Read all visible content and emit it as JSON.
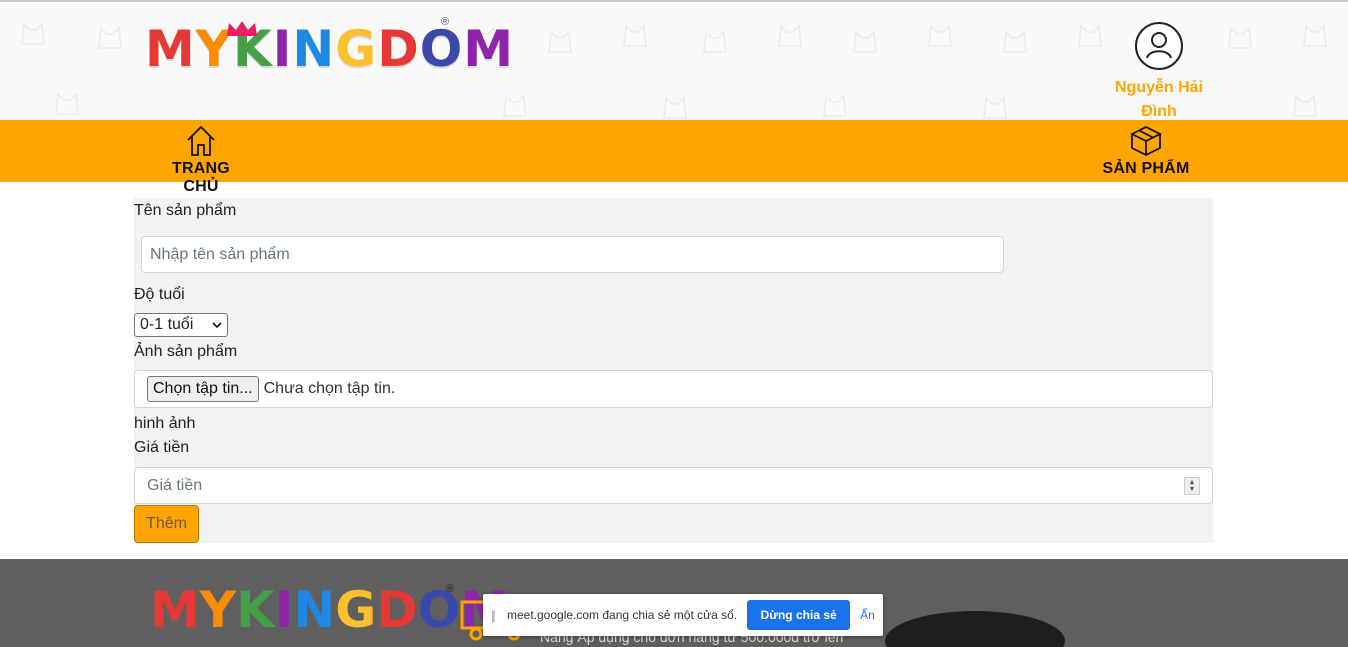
{
  "header": {
    "logo_text": "MYKINGDOM",
    "logo_registered": "®",
    "user_name": "Nguyễn Hải Đình"
  },
  "nav": {
    "home_label": "TRANG CHỦ",
    "products_label": "SẢN PHẨM"
  },
  "form": {
    "name_label": "Tên sản phẩm",
    "name_placeholder": "Nhập tên sản phẩm",
    "name_value": "",
    "age_label": "Độ tuổi",
    "age_selected": "0-1 tuổi",
    "image_label": "Ảnh sản phẩm",
    "file_button": "Chọn tập tin...",
    "file_status": "Chưa chọn tập tin.",
    "image_caption": "hinh ảnh",
    "price_label": "Giá tiền",
    "price_placeholder": "Giá tiền",
    "price_value": "",
    "submit_label": "Thêm"
  },
  "footer": {
    "logo_text": "MYKINGDOM",
    "logo_registered": "®",
    "shipping_text": "Nâng Áp dụng cho đơn hàng từ 500.000đ trở lên"
  },
  "share_bar": {
    "message": "meet.google.com đang chia sẻ một cửa sổ.",
    "stop_label": "Dừng chia sẻ",
    "hide_label": "Ẩn"
  },
  "colors": {
    "accent": "#ffa500",
    "footer_bg": "#5f5f5f",
    "share_button": "#1a73e8"
  },
  "icons": [
    "home-icon",
    "box-icon",
    "user-icon",
    "chevron-down-icon",
    "truck-icon",
    "drag-handle-icon"
  ]
}
